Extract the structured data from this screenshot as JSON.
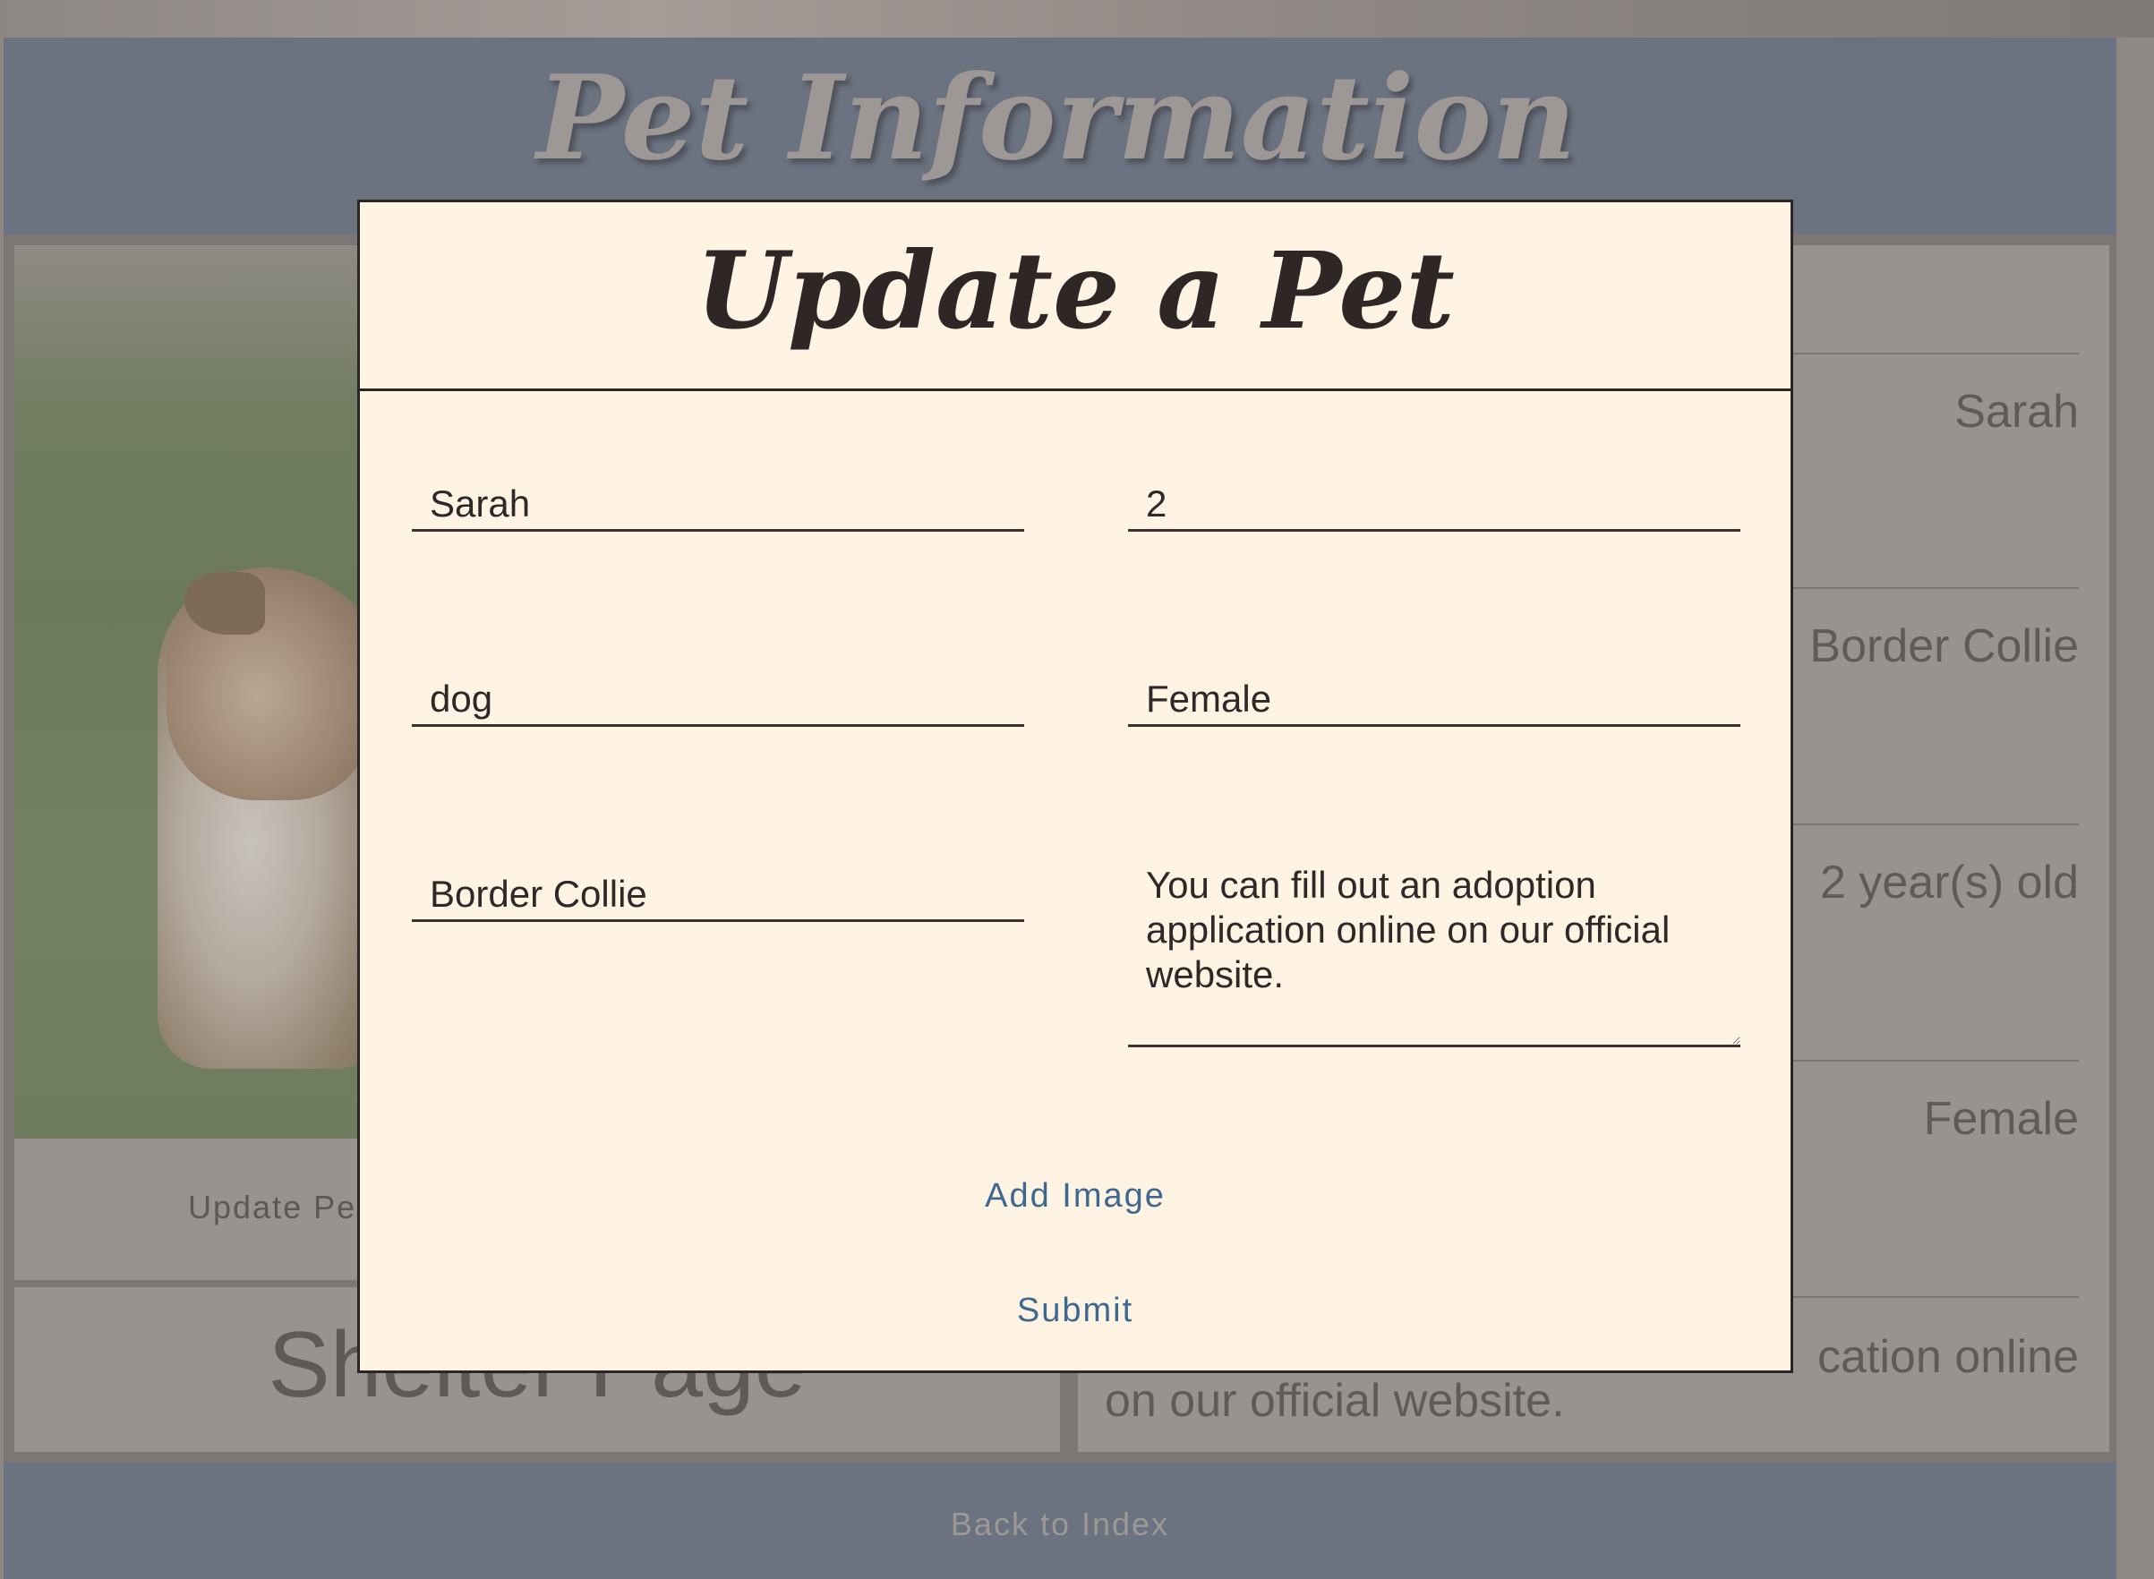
{
  "page": {
    "title": "Pet Information"
  },
  "pet_card": {
    "update_label": "Update Pe",
    "shelter_link": "Shelter Page"
  },
  "pet_details": {
    "name": "Sarah",
    "breed": "Border Collie",
    "age": "2 year(s) old",
    "sex": "Female",
    "description_partial": "cation online",
    "description_line2": "on our official website."
  },
  "footer": {
    "back_link": "Back to Index"
  },
  "modal": {
    "title": "Update a Pet",
    "fields": {
      "name": "Sarah",
      "age": "2",
      "species": "dog",
      "sex": "Female",
      "breed": "Border Collie",
      "description": "You can fill out an adoption application online on our official website."
    },
    "add_image_label": "Add Image",
    "submit_label": "Submit"
  },
  "colors": {
    "overlay": "#8a8785",
    "modal_bg": "#fff3e4",
    "header_bg": "#6b7280",
    "link": "#3f6890"
  }
}
